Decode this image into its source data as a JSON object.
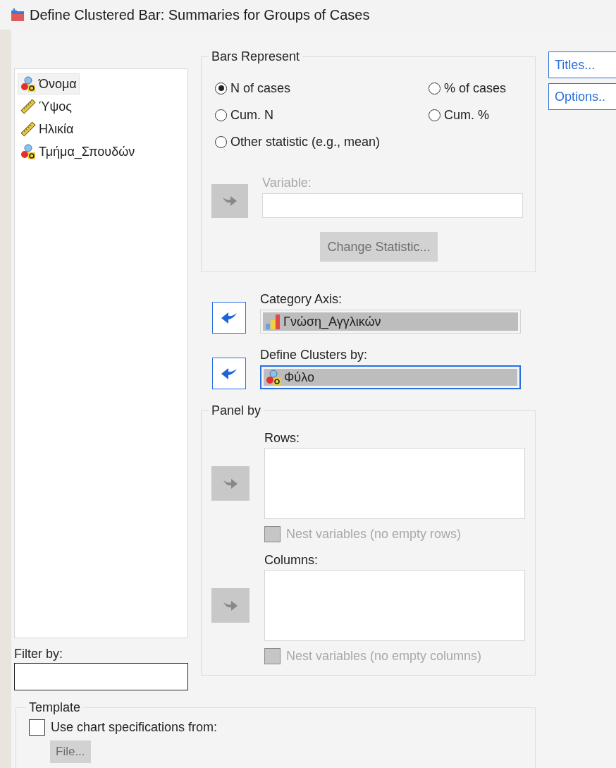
{
  "window": {
    "title": "Define Clustered Bar: Summaries for Groups of Cases"
  },
  "variables": {
    "items": [
      {
        "name": "Όνομα",
        "kind": "nominal",
        "selected": true
      },
      {
        "name": "Ύψος",
        "kind": "scale",
        "selected": false
      },
      {
        "name": "Ηλικία",
        "kind": "scale",
        "selected": false
      },
      {
        "name": "Τμήμα_Σπουδών",
        "kind": "nominal",
        "selected": false
      }
    ]
  },
  "filter": {
    "label": "Filter by:"
  },
  "bars_represent": {
    "title": "Bars Represent",
    "options": [
      {
        "label": "N of cases",
        "selected": true
      },
      {
        "label": "% of cases",
        "selected": false
      },
      {
        "label": "Cum. N",
        "selected": false
      },
      {
        "label": "Cum. %",
        "selected": false
      },
      {
        "label": "Other statistic (e.g., mean)",
        "selected": false
      }
    ],
    "variable": {
      "label": "Variable:",
      "disabled": true
    },
    "change_statistic": {
      "label": "Change Statistic...",
      "disabled": true
    }
  },
  "category_axis": {
    "label": "Category Axis:",
    "value": "Γνώση_Αγγλικών",
    "kind": "ordinal",
    "disabled": false,
    "focused": false
  },
  "define_clusters": {
    "label": "Define Clusters by:",
    "value": "Φύλο",
    "kind": "nominal",
    "disabled": false,
    "focused": true
  },
  "panel_by": {
    "title": "Panel by",
    "targets": [
      {
        "label": "Rows:",
        "disabled": true,
        "nest": {
          "label": "Nest variables (no empty rows)",
          "checked": false,
          "disabled": true
        }
      },
      {
        "label": "Columns:",
        "disabled": true,
        "nest": {
          "label": "Nest variables (no empty columns)",
          "checked": false,
          "disabled": true
        }
      }
    ]
  },
  "buttons": [
    {
      "label": "Titles..."
    },
    {
      "label": "Options.."
    }
  ],
  "template": {
    "title": "Template",
    "use": {
      "label": "Use chart specifications from:",
      "checked": false
    },
    "file": {
      "label": "File...",
      "disabled": true
    }
  }
}
